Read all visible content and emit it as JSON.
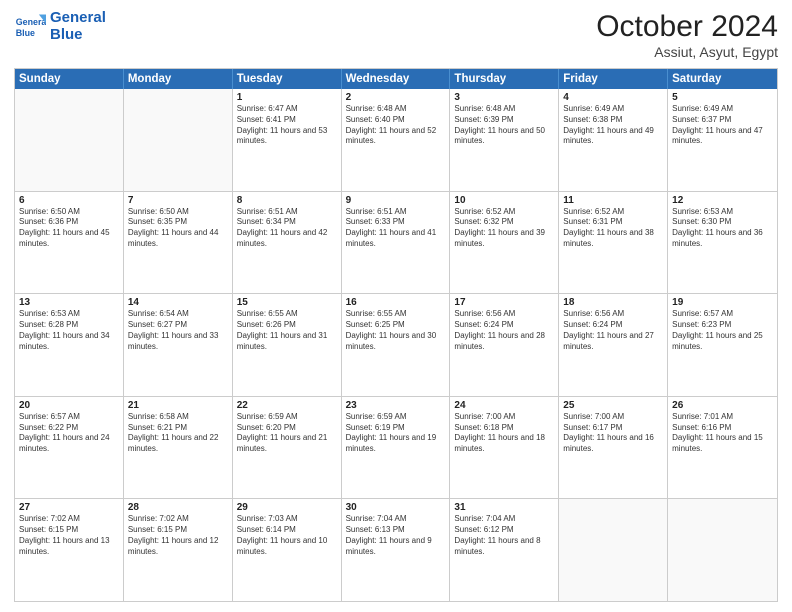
{
  "header": {
    "logo_general": "General",
    "logo_blue": "Blue",
    "month_year": "October 2024",
    "location": "Assiut, Asyut, Egypt"
  },
  "days": [
    "Sunday",
    "Monday",
    "Tuesday",
    "Wednesday",
    "Thursday",
    "Friday",
    "Saturday"
  ],
  "rows": [
    [
      {
        "day": "",
        "empty": true
      },
      {
        "day": "",
        "empty": true
      },
      {
        "day": "1",
        "sunrise": "Sunrise: 6:47 AM",
        "sunset": "Sunset: 6:41 PM",
        "daylight": "Daylight: 11 hours and 53 minutes."
      },
      {
        "day": "2",
        "sunrise": "Sunrise: 6:48 AM",
        "sunset": "Sunset: 6:40 PM",
        "daylight": "Daylight: 11 hours and 52 minutes."
      },
      {
        "day": "3",
        "sunrise": "Sunrise: 6:48 AM",
        "sunset": "Sunset: 6:39 PM",
        "daylight": "Daylight: 11 hours and 50 minutes."
      },
      {
        "day": "4",
        "sunrise": "Sunrise: 6:49 AM",
        "sunset": "Sunset: 6:38 PM",
        "daylight": "Daylight: 11 hours and 49 minutes."
      },
      {
        "day": "5",
        "sunrise": "Sunrise: 6:49 AM",
        "sunset": "Sunset: 6:37 PM",
        "daylight": "Daylight: 11 hours and 47 minutes."
      }
    ],
    [
      {
        "day": "6",
        "sunrise": "Sunrise: 6:50 AM",
        "sunset": "Sunset: 6:36 PM",
        "daylight": "Daylight: 11 hours and 45 minutes."
      },
      {
        "day": "7",
        "sunrise": "Sunrise: 6:50 AM",
        "sunset": "Sunset: 6:35 PM",
        "daylight": "Daylight: 11 hours and 44 minutes."
      },
      {
        "day": "8",
        "sunrise": "Sunrise: 6:51 AM",
        "sunset": "Sunset: 6:34 PM",
        "daylight": "Daylight: 11 hours and 42 minutes."
      },
      {
        "day": "9",
        "sunrise": "Sunrise: 6:51 AM",
        "sunset": "Sunset: 6:33 PM",
        "daylight": "Daylight: 11 hours and 41 minutes."
      },
      {
        "day": "10",
        "sunrise": "Sunrise: 6:52 AM",
        "sunset": "Sunset: 6:32 PM",
        "daylight": "Daylight: 11 hours and 39 minutes."
      },
      {
        "day": "11",
        "sunrise": "Sunrise: 6:52 AM",
        "sunset": "Sunset: 6:31 PM",
        "daylight": "Daylight: 11 hours and 38 minutes."
      },
      {
        "day": "12",
        "sunrise": "Sunrise: 6:53 AM",
        "sunset": "Sunset: 6:30 PM",
        "daylight": "Daylight: 11 hours and 36 minutes."
      }
    ],
    [
      {
        "day": "13",
        "sunrise": "Sunrise: 6:53 AM",
        "sunset": "Sunset: 6:28 PM",
        "daylight": "Daylight: 11 hours and 34 minutes."
      },
      {
        "day": "14",
        "sunrise": "Sunrise: 6:54 AM",
        "sunset": "Sunset: 6:27 PM",
        "daylight": "Daylight: 11 hours and 33 minutes."
      },
      {
        "day": "15",
        "sunrise": "Sunrise: 6:55 AM",
        "sunset": "Sunset: 6:26 PM",
        "daylight": "Daylight: 11 hours and 31 minutes."
      },
      {
        "day": "16",
        "sunrise": "Sunrise: 6:55 AM",
        "sunset": "Sunset: 6:25 PM",
        "daylight": "Daylight: 11 hours and 30 minutes."
      },
      {
        "day": "17",
        "sunrise": "Sunrise: 6:56 AM",
        "sunset": "Sunset: 6:24 PM",
        "daylight": "Daylight: 11 hours and 28 minutes."
      },
      {
        "day": "18",
        "sunrise": "Sunrise: 6:56 AM",
        "sunset": "Sunset: 6:24 PM",
        "daylight": "Daylight: 11 hours and 27 minutes."
      },
      {
        "day": "19",
        "sunrise": "Sunrise: 6:57 AM",
        "sunset": "Sunset: 6:23 PM",
        "daylight": "Daylight: 11 hours and 25 minutes."
      }
    ],
    [
      {
        "day": "20",
        "sunrise": "Sunrise: 6:57 AM",
        "sunset": "Sunset: 6:22 PM",
        "daylight": "Daylight: 11 hours and 24 minutes."
      },
      {
        "day": "21",
        "sunrise": "Sunrise: 6:58 AM",
        "sunset": "Sunset: 6:21 PM",
        "daylight": "Daylight: 11 hours and 22 minutes."
      },
      {
        "day": "22",
        "sunrise": "Sunrise: 6:59 AM",
        "sunset": "Sunset: 6:20 PM",
        "daylight": "Daylight: 11 hours and 21 minutes."
      },
      {
        "day": "23",
        "sunrise": "Sunrise: 6:59 AM",
        "sunset": "Sunset: 6:19 PM",
        "daylight": "Daylight: 11 hours and 19 minutes."
      },
      {
        "day": "24",
        "sunrise": "Sunrise: 7:00 AM",
        "sunset": "Sunset: 6:18 PM",
        "daylight": "Daylight: 11 hours and 18 minutes."
      },
      {
        "day": "25",
        "sunrise": "Sunrise: 7:00 AM",
        "sunset": "Sunset: 6:17 PM",
        "daylight": "Daylight: 11 hours and 16 minutes."
      },
      {
        "day": "26",
        "sunrise": "Sunrise: 7:01 AM",
        "sunset": "Sunset: 6:16 PM",
        "daylight": "Daylight: 11 hours and 15 minutes."
      }
    ],
    [
      {
        "day": "27",
        "sunrise": "Sunrise: 7:02 AM",
        "sunset": "Sunset: 6:15 PM",
        "daylight": "Daylight: 11 hours and 13 minutes."
      },
      {
        "day": "28",
        "sunrise": "Sunrise: 7:02 AM",
        "sunset": "Sunset: 6:15 PM",
        "daylight": "Daylight: 11 hours and 12 minutes."
      },
      {
        "day": "29",
        "sunrise": "Sunrise: 7:03 AM",
        "sunset": "Sunset: 6:14 PM",
        "daylight": "Daylight: 11 hours and 10 minutes."
      },
      {
        "day": "30",
        "sunrise": "Sunrise: 7:04 AM",
        "sunset": "Sunset: 6:13 PM",
        "daylight": "Daylight: 11 hours and 9 minutes."
      },
      {
        "day": "31",
        "sunrise": "Sunrise: 7:04 AM",
        "sunset": "Sunset: 6:12 PM",
        "daylight": "Daylight: 11 hours and 8 minutes."
      },
      {
        "day": "",
        "empty": true
      },
      {
        "day": "",
        "empty": true
      }
    ]
  ]
}
